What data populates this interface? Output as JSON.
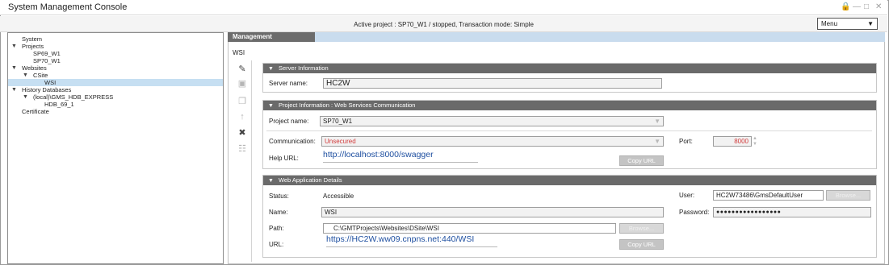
{
  "window": {
    "title": "System Management Console",
    "controls": [
      "lock-icon",
      "minimize-icon",
      "maximize-icon",
      "close-icon"
    ]
  },
  "status": {
    "text": "Active project : SP70_W1 / stopped, Transaction mode: Simple",
    "menu_label": "Menu"
  },
  "tree": {
    "items": [
      {
        "label": "System"
      },
      {
        "label": "Projects"
      },
      {
        "label": "SP69_W1"
      },
      {
        "label": "SP70_W1"
      },
      {
        "label": "Websites"
      },
      {
        "label": "CSite"
      },
      {
        "label": "WSI"
      },
      {
        "label": "History Databases"
      },
      {
        "label": "(local)\\GMS_HDB_EXPRESS"
      },
      {
        "label": "HDB_69_1"
      },
      {
        "label": "Certificate"
      }
    ]
  },
  "management": {
    "tab_label": "Management",
    "breadcrumb": "WSI"
  },
  "toolbar_icons": [
    "edit-icon",
    "save-icon",
    "copy-icon",
    "upload-icon",
    "delete-icon",
    "hierarchy-icon"
  ],
  "server": {
    "header": "Server Information",
    "name_label": "Server name:",
    "name_value": "HC2W"
  },
  "project": {
    "header": "Project Information : Web Services Communication",
    "name_label": "Project name:",
    "name_value": "SP70_W1",
    "comm_label": "Communication:",
    "comm_value": "Unsecured",
    "port_label": "Port:",
    "port_value": "8000",
    "help_label": "Help URL:",
    "help_value": "http://localhost:8000/swagger",
    "copy_label": "Copy URL"
  },
  "webapp": {
    "header": "Web Application Details",
    "status_label": "Status:",
    "status_value": "Accessible",
    "name_label": "Name:",
    "name_value": "WSI",
    "path_label": "Path:",
    "path_value": "C:\\GMTProjects\\Websites\\DSite\\WSI",
    "browse_label": "Browse...",
    "url_label": "URL:",
    "url_value": "https://HC2W.ww09.cnpns.net:440/WSI",
    "copy_label": "Copy URL",
    "user_label": "User:",
    "user_value": "HC2W73486\\GmsDefaultUser",
    "user_browse_label": "Browse...",
    "password_label": "Password:",
    "password_value": "●●●●●●●●●●●●●●●●●"
  }
}
